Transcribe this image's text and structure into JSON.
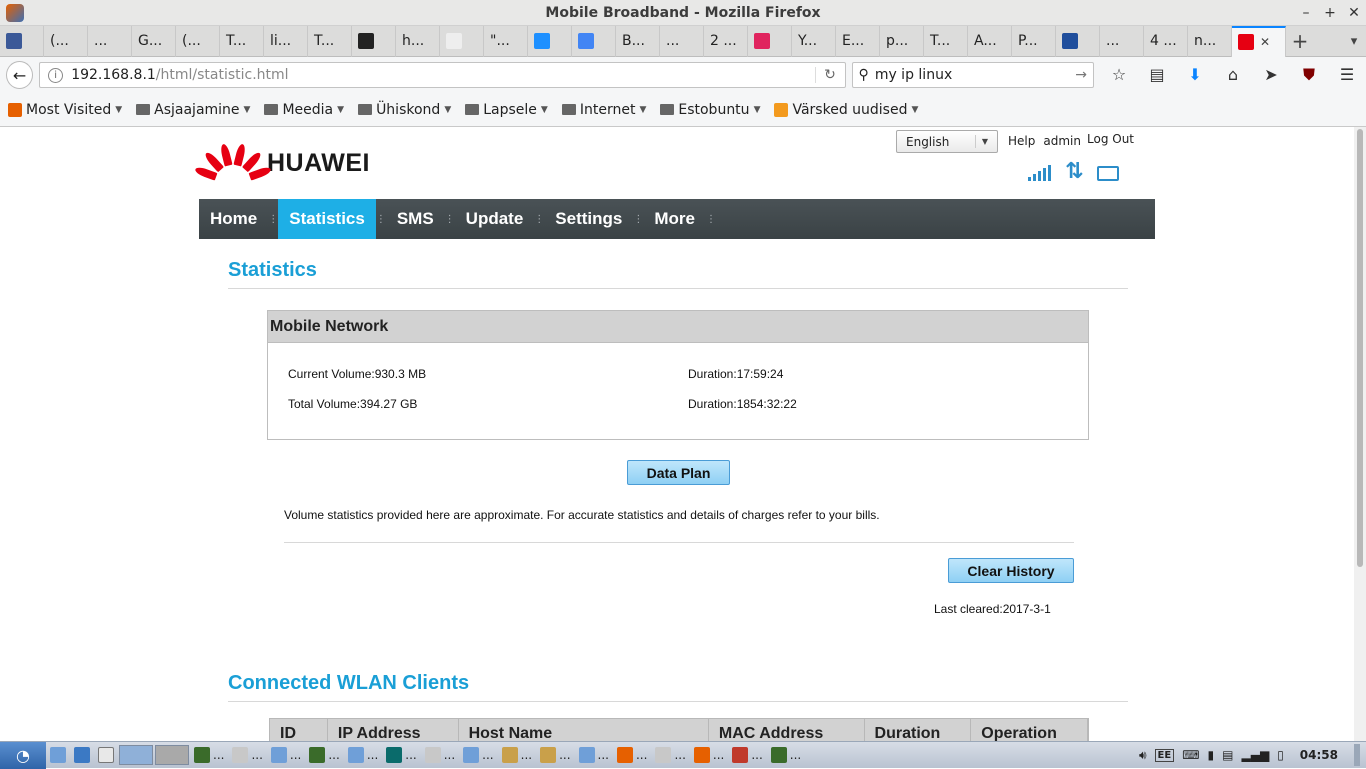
{
  "window": {
    "title": "Mobile Broadband - Mozilla Firefox"
  },
  "tabs": [
    {
      "label": "",
      "color": "#3b5998"
    },
    {
      "label": "(...",
      "color": ""
    },
    {
      "label": "...",
      "color": ""
    },
    {
      "label": "G...",
      "color": ""
    },
    {
      "label": "(...",
      "color": ""
    },
    {
      "label": "T...",
      "color": ""
    },
    {
      "label": "li...",
      "color": ""
    },
    {
      "label": "T...",
      "color": ""
    },
    {
      "label": "",
      "color": "#222222"
    },
    {
      "label": "h...",
      "color": ""
    },
    {
      "label": "",
      "color": "#eeeeee"
    },
    {
      "label": "\"...",
      "color": ""
    },
    {
      "label": "",
      "color": "#1e90ff"
    },
    {
      "label": "",
      "color": "#4285f4"
    },
    {
      "label": "B...",
      "color": ""
    },
    {
      "label": "...",
      "color": ""
    },
    {
      "label": "2 ...",
      "color": ""
    },
    {
      "label": "",
      "color": "#e0245e"
    },
    {
      "label": "Y...",
      "color": ""
    },
    {
      "label": "E...",
      "color": ""
    },
    {
      "label": "p...",
      "color": ""
    },
    {
      "label": "T...",
      "color": ""
    },
    {
      "label": "A...",
      "color": ""
    },
    {
      "label": "P...",
      "color": ""
    },
    {
      "label": "",
      "color": "#1f4e9c"
    },
    {
      "label": "...",
      "color": ""
    },
    {
      "label": "4 ...",
      "color": ""
    },
    {
      "label": "n...",
      "color": ""
    }
  ],
  "active_tab": {
    "close": "✕",
    "color": "#e60012"
  },
  "nav": {
    "url_host": "192.168.8.1",
    "url_path": "/html/statistic.html",
    "search_value": "my ip linux"
  },
  "bookmarks": [
    {
      "label": "Most Visited",
      "icon": "firefox-icon"
    },
    {
      "label": "Asjaajamine",
      "icon": "folder-icon"
    },
    {
      "label": "Meedia",
      "icon": "folder-icon"
    },
    {
      "label": "Ühiskond",
      "icon": "folder-icon"
    },
    {
      "label": "Lapsele",
      "icon": "folder-icon"
    },
    {
      "label": "Internet",
      "icon": "folder-icon"
    },
    {
      "label": "Estobuntu",
      "icon": "folder-icon"
    },
    {
      "label": "Värsked uudised",
      "icon": "rss-icon"
    }
  ],
  "router": {
    "brand": "HUAWEI",
    "language": "English",
    "help": "Help",
    "user": "admin",
    "logout": "Log Out",
    "menu": [
      "Home",
      "Statistics",
      "SMS",
      "Update",
      "Settings",
      "More"
    ],
    "active_menu": "Statistics",
    "accent": "#1eafe6"
  },
  "statistics": {
    "heading": "Statistics",
    "panel_title": "Mobile Network",
    "current_volume": "Current Volume:930.3 MB",
    "current_duration": "Duration:17:59:24",
    "total_volume": "Total Volume:394.27 GB",
    "total_duration": "Duration:1854:32:22",
    "data_plan_button": "Data Plan",
    "note": "Volume statistics provided here are approximate. For accurate statistics and details of charges refer to your bills.",
    "clear_button": "Clear History",
    "last_cleared": "Last cleared:2017-3-1"
  },
  "wlan": {
    "heading": "Connected WLAN Clients",
    "columns": [
      "ID",
      "IP Address",
      "Host Name",
      "MAC Address",
      "Duration",
      "Operation"
    ]
  },
  "taskbar": {
    "items": [
      "...",
      "...",
      "...",
      "...",
      "...",
      "...",
      "...",
      "...",
      "...",
      "...",
      "...",
      "...",
      "...",
      "...",
      "...",
      "..."
    ],
    "keyboard_layout": "EE",
    "clock": "04:58"
  }
}
